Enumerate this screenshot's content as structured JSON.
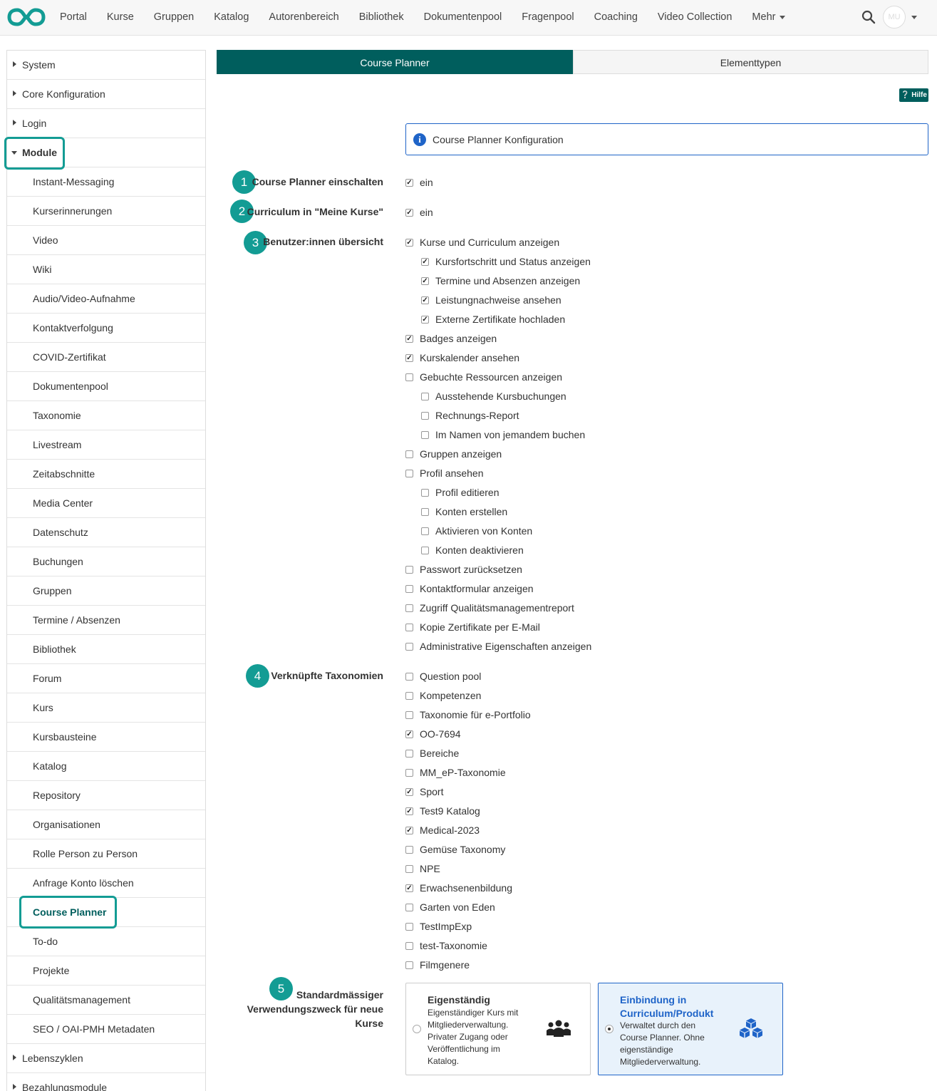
{
  "colors": {
    "primary": "#005e5d",
    "accent": "#139c94",
    "info": "#1f64c8"
  },
  "topnav": {
    "logo_icon": "infinity-logo-icon",
    "items": [
      "Portal",
      "Kurse",
      "Gruppen",
      "Katalog",
      "Autorenbereich",
      "Bibliothek",
      "Dokumentenpool",
      "Fragenpool",
      "Coaching",
      "Video Collection",
      "Mehr"
    ],
    "search_icon": "search-icon",
    "avatar_initials": "MU"
  },
  "sidebar": {
    "top_items": [
      "System",
      "Core Konfiguration",
      "Login",
      "Module"
    ],
    "sub_items": [
      "Instant-Messaging",
      "Kurserinnerungen",
      "Video",
      "Wiki",
      "Audio/Video-Aufnahme",
      "Kontaktverfolgung",
      "COVID-Zertifikat",
      "Dokumentenpool",
      "Taxonomie",
      "Livestream",
      "Zeitabschnitte",
      "Media Center",
      "Datenschutz",
      "Buchungen",
      "Gruppen",
      "Termine / Absenzen",
      "Bibliothek",
      "Forum",
      "Kurs",
      "Kursbausteine",
      "Katalog",
      "Repository",
      "Organisationen",
      "Rolle Person zu Person",
      "Anfrage Konto löschen",
      "Course Planner",
      "To-do",
      "Projekte",
      "Qualitätsmanagement",
      "SEO / OAI-PMH Metadaten"
    ],
    "bottom_items": [
      "Lebenszyklen",
      "Bezahlungsmodule"
    ],
    "active_item": "Course Planner"
  },
  "tabs": [
    "Course Planner",
    "Elementtypen"
  ],
  "help_label": "Hilfe",
  "info_text": "Course Planner Konfiguration",
  "badges": [
    "1",
    "2",
    "3",
    "4",
    "5"
  ],
  "fields": {
    "enable_label": "Course Planner einschalten",
    "enable_value": "ein",
    "curriculum_label": "Curriculum in \"Meine Kurse\"",
    "curriculum_value": "ein",
    "overview_label": "Benutzer:innen übersicht",
    "taxonomy_label": "Verknüpfte Taxonomien",
    "usage_label": "Standardmässiger Verwendungszweck für neue Kurse"
  },
  "overview_options": [
    {
      "label": "Kurse und Curriculum anzeigen",
      "checked": true,
      "indent": 0
    },
    {
      "label": "Kursfortschritt und Status anzeigen",
      "checked": true,
      "indent": 1
    },
    {
      "label": "Termine und Absenzen anzeigen",
      "checked": true,
      "indent": 1
    },
    {
      "label": "Leistungnachweise ansehen",
      "checked": true,
      "indent": 1
    },
    {
      "label": "Externe Zertifikate hochladen",
      "checked": true,
      "indent": 1
    },
    {
      "label": "Badges anzeigen",
      "checked": true,
      "indent": 0
    },
    {
      "label": "Kurskalender ansehen",
      "checked": true,
      "indent": 0
    },
    {
      "label": "Gebuchte Ressourcen anzeigen",
      "checked": false,
      "indent": 0
    },
    {
      "label": "Ausstehende Kursbuchungen",
      "checked": false,
      "indent": 1
    },
    {
      "label": "Rechnungs-Report",
      "checked": false,
      "indent": 1
    },
    {
      "label": "Im Namen von jemandem buchen",
      "checked": false,
      "indent": 1
    },
    {
      "label": "Gruppen anzeigen",
      "checked": false,
      "indent": 0
    },
    {
      "label": "Profil ansehen",
      "checked": false,
      "indent": 0
    },
    {
      "label": "Profil editieren",
      "checked": false,
      "indent": 1
    },
    {
      "label": "Konten erstellen",
      "checked": false,
      "indent": 1
    },
    {
      "label": "Aktivieren von Konten",
      "checked": false,
      "indent": 1
    },
    {
      "label": "Konten deaktivieren",
      "checked": false,
      "indent": 1
    },
    {
      "label": "Passwort zurücksetzen",
      "checked": false,
      "indent": 0
    },
    {
      "label": "Kontaktformular anzeigen",
      "checked": false,
      "indent": 0
    },
    {
      "label": "Zugriff Qualitätsmanagementreport",
      "checked": false,
      "indent": 0
    },
    {
      "label": "Kopie Zertifikate per E-Mail",
      "checked": false,
      "indent": 0
    },
    {
      "label": "Administrative Eigenschaften anzeigen",
      "checked": false,
      "indent": 0
    }
  ],
  "taxonomies": [
    {
      "label": "Question pool",
      "checked": false
    },
    {
      "label": "Kompetenzen",
      "checked": false
    },
    {
      "label": "Taxonomie für e-Portfolio",
      "checked": false
    },
    {
      "label": "OO-7694",
      "checked": true
    },
    {
      "label": "Bereiche",
      "checked": false
    },
    {
      "label": "MM_eP-Taxonomie",
      "checked": false
    },
    {
      "label": "Sport",
      "checked": true
    },
    {
      "label": "Test9 Katalog",
      "checked": true
    },
    {
      "label": "Medical-2023",
      "checked": true
    },
    {
      "label": "Gemüse Taxonomy",
      "checked": false
    },
    {
      "label": "NPE",
      "checked": false
    },
    {
      "label": "Erwachsenenbildung",
      "checked": true
    },
    {
      "label": "Garten von Eden",
      "checked": false
    },
    {
      "label": "TestImpExp",
      "checked": false
    },
    {
      "label": "test-Taxonomie",
      "checked": false
    },
    {
      "label": "Filmgenere",
      "checked": false
    }
  ],
  "usage_cards": [
    {
      "title": "Eigenständig",
      "description": "Eigenständiger Kurs mit Mitgliederverwaltung. Privater Zugang oder Veröffentlichung im Katalog.",
      "selected": false,
      "icon": "group-people-icon"
    },
    {
      "title": "Einbindung in Curriculum/Produkt",
      "description": "Verwaltet durch den Course Planner. Ohne eigenständige Mitgliederverwaltung.",
      "selected": true,
      "icon": "cubes-icon"
    }
  ]
}
